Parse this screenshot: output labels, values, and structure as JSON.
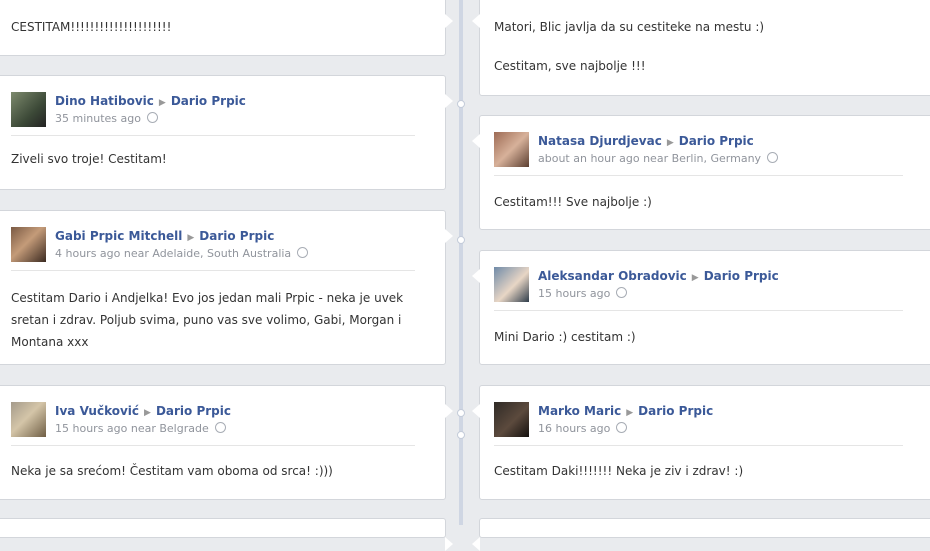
{
  "left_posts": [
    {
      "message": "CESTITAM!!!!!!!!!!!!!!!!!!!!!"
    },
    {
      "author": "Dino Hatibovic",
      "target": "Dario Prpic",
      "time": "35 minutes ago",
      "message": "Ziveli svo troje! Cestitam!"
    },
    {
      "author": "Gabi Prpic Mitchell",
      "target": "Dario Prpic",
      "time": "4 hours ago near Adelaide, South Australia",
      "message": "Cestitam Dario i Andjelka! Evo jos jedan mali Prpic - neka je uvek sretan i zdrav. Poljub svima, puno vas sve volimo, Gabi, Morgan i Montana xxx"
    },
    {
      "author": "Iva Vučković",
      "target": "Dario Prpic",
      "time": "15 hours ago near Belgrade",
      "message": "Neka je sa srećom! Čestitam vam oboma od srca! :)))"
    }
  ],
  "right_posts": [
    {
      "message": "Matori, Blic javlja da su cestiteke na mestu :)",
      "message2": "Cestitam, sve najbolje !!!"
    },
    {
      "author": "Natasa Djurdjevac",
      "target": "Dario Prpic",
      "time": "about an hour ago near Berlin, Germany",
      "message": "Cestitam!!! Sve najbolje :)"
    },
    {
      "author": "Aleksandar Obradovic",
      "target": "Dario Prpic",
      "time": "15 hours ago",
      "message": "Mini Dario :) cestitam :)"
    },
    {
      "author": "Marko Maric",
      "target": "Dario Prpic",
      "time": "16 hours ago",
      "message": "Cestitam Daki!!!!!!! Neka je ziv i zdrav! :)"
    }
  ],
  "icons": {
    "arrow": "triangle-right-icon",
    "privacy": "globe-icon"
  }
}
